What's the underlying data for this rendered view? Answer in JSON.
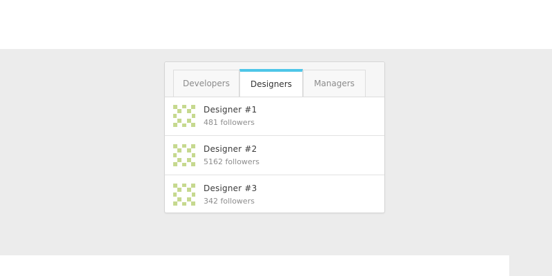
{
  "tabs": [
    {
      "label": "Developers"
    },
    {
      "label": "Designers"
    },
    {
      "label": "Managers"
    }
  ],
  "active_tab": "Designers",
  "colors": {
    "accent": "#4ec6e8",
    "avatar": "#c6d98f",
    "background": "#ececec"
  },
  "people": [
    {
      "name": "Designer #1",
      "followers": "481 followers",
      "avatar_icon": "identicon"
    },
    {
      "name": "Designer #2",
      "followers": "5162 followers",
      "avatar_icon": "identicon"
    },
    {
      "name": "Designer #3",
      "followers": "342 followers",
      "avatar_icon": "identicon"
    }
  ]
}
